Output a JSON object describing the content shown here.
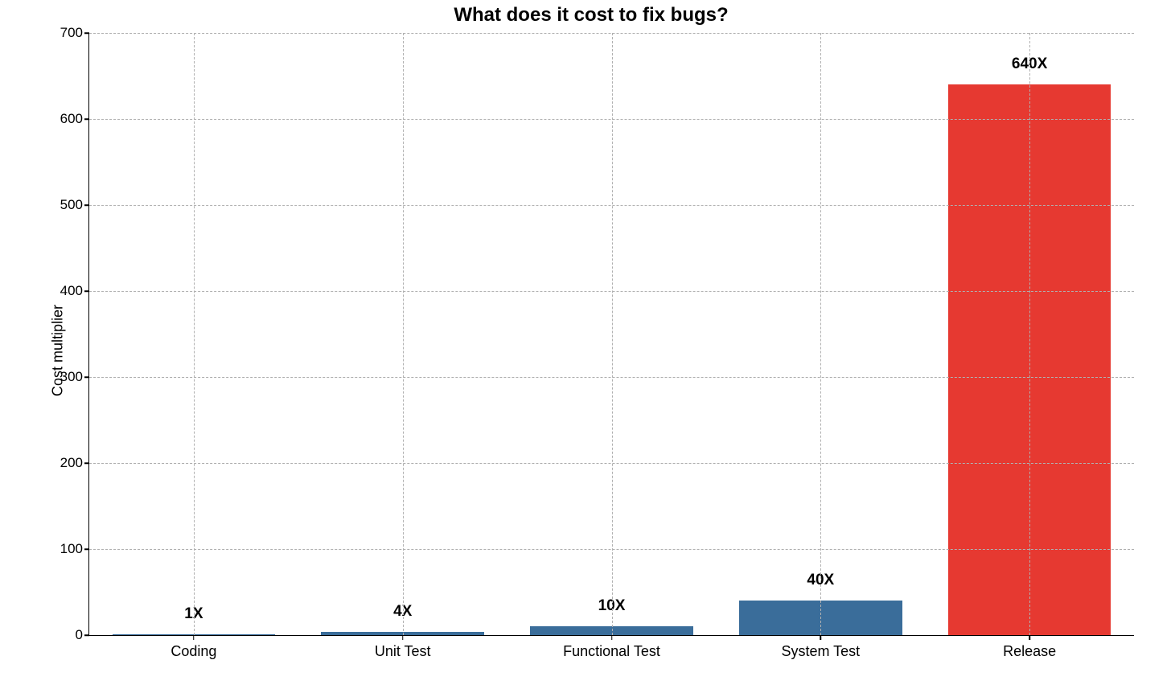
{
  "chart_data": {
    "type": "bar",
    "title": "What does it cost to fix bugs?",
    "ylabel": "Cost multiplier",
    "xlabel": "",
    "categories": [
      "Coding",
      "Unit Test",
      "Functional Test",
      "System Test",
      "Release"
    ],
    "values": [
      1,
      4,
      10,
      40,
      640
    ],
    "data_labels": [
      "1X",
      "4X",
      "10X",
      "40X",
      "640X"
    ],
    "colors": [
      "#3a6d9a",
      "#3a6d9a",
      "#3a6d9a",
      "#3a6d9a",
      "#e63931"
    ],
    "ylim": [
      0,
      700
    ],
    "y_ticks": [
      0,
      100,
      200,
      300,
      400,
      500,
      600,
      700
    ],
    "grid": true
  }
}
